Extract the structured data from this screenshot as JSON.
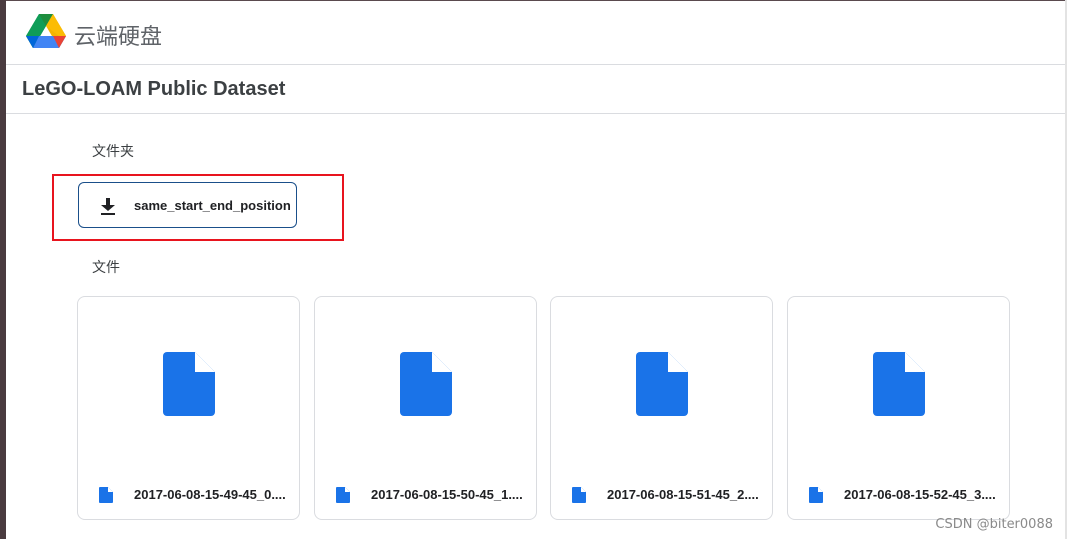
{
  "app": {
    "name": "云端硬盘",
    "logo_icon": "google-drive-logo"
  },
  "page": {
    "title": "LeGO-LOAM Public Dataset"
  },
  "folders_section": {
    "label": "文件夹",
    "items": [
      {
        "name": "same_start_end_position",
        "icon": "download-icon"
      }
    ]
  },
  "files_section": {
    "label": "文件",
    "items": [
      {
        "name": "2017-06-08-15-49-45_0....",
        "icon": "file-icon"
      },
      {
        "name": "2017-06-08-15-50-45_1....",
        "icon": "file-icon"
      },
      {
        "name": "2017-06-08-15-51-45_2....",
        "icon": "file-icon"
      },
      {
        "name": "2017-06-08-15-52-45_3....",
        "icon": "file-icon"
      }
    ]
  },
  "watermark": "CSDN @biter0088",
  "colors": {
    "accent_blue": "#1a73e8",
    "highlight_red": "#e8141e",
    "border_gray": "#dadce0"
  }
}
